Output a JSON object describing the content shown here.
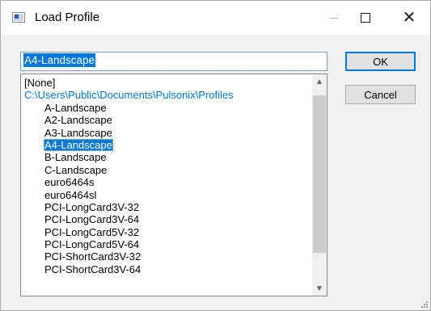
{
  "window": {
    "title": "Load Profile"
  },
  "input": {
    "value": "A4-Landscape"
  },
  "list": {
    "root_item": "[None]",
    "folder_path": "C:\\Users\\Public\\Documents\\Pulsonix\\Profiles",
    "items": [
      "A-Landscape",
      "A2-Landscape",
      "A3-Landscape",
      "A4-Landscape",
      "B-Landscape",
      "C-Landscape",
      "euro6464s",
      "euro6464sl",
      "PCI-LongCard3V-32",
      "PCI-LongCard3V-64",
      "PCI-LongCard5V-32",
      "PCI-LongCard5V-64",
      "PCI-ShortCard3V-32",
      "PCI-ShortCard3V-64"
    ],
    "selected_item": "A4-Landscape"
  },
  "buttons": {
    "ok": "OK",
    "cancel": "Cancel"
  },
  "colors": {
    "accent": "#0078d7",
    "dialog_bg": "#f0f0f0"
  }
}
